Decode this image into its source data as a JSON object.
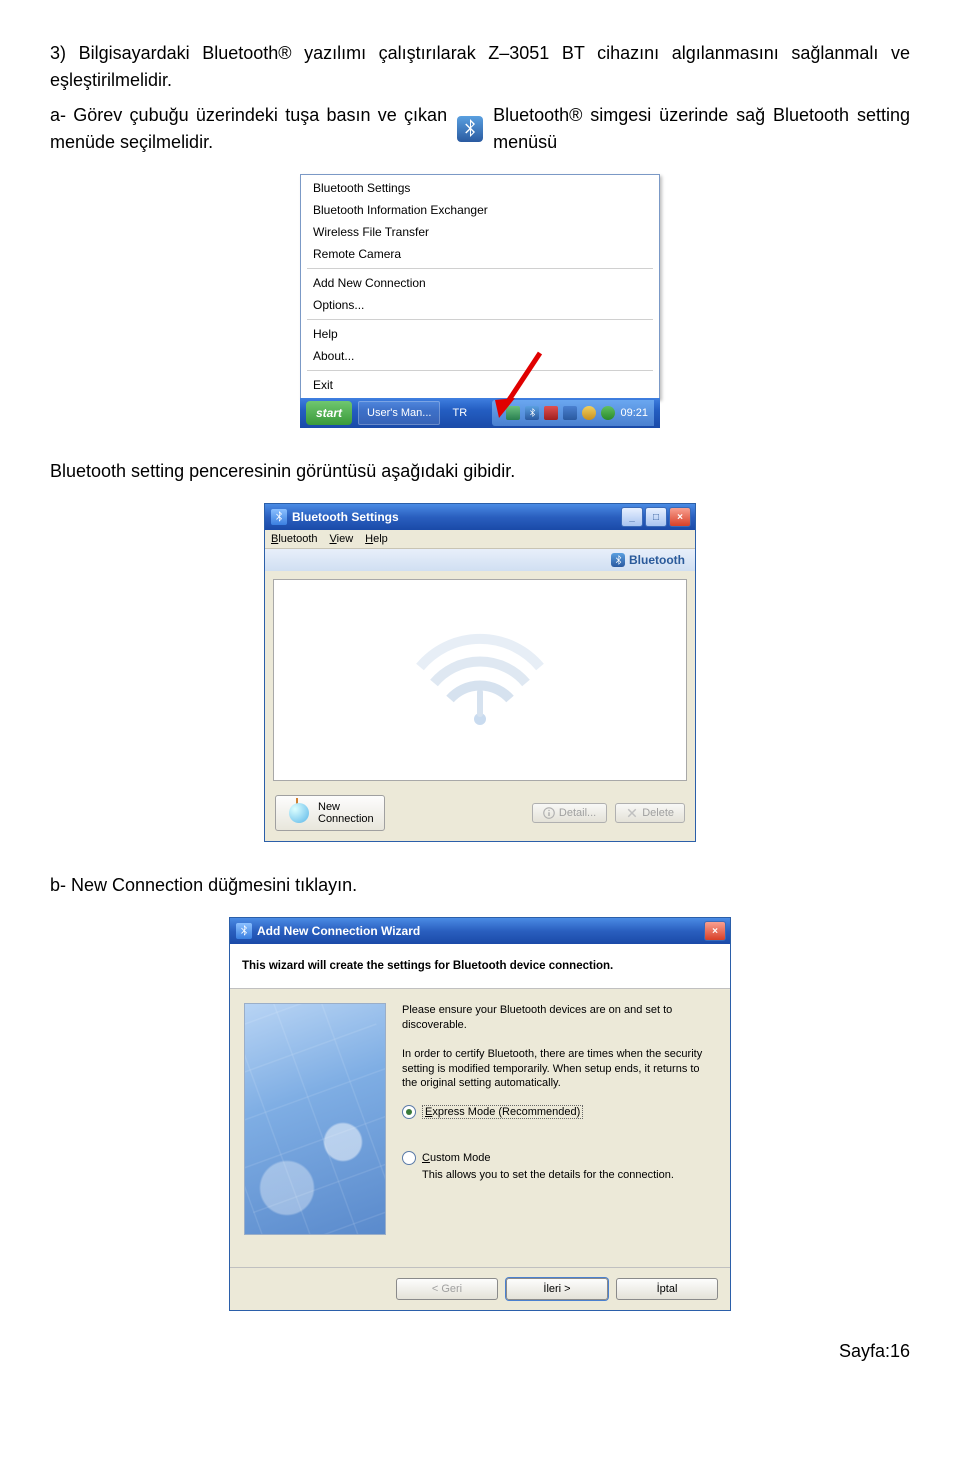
{
  "para1": "3) Bilgisayardaki Bluetooth® yazılımı çalıştırılarak Z–3051 BT cihazını algılanmasını sağlanmalı ve eşleştirilmelidir.",
  "para2_left": "a- Görev çubuğu üzerindeki tuşa basın ve çıkan menüde seçilmelidir.",
  "para2_right": "Bluetooth® simgesi üzerinde sağ Bluetooth setting menüsü",
  "context_menu": {
    "items_a": [
      "Bluetooth Settings",
      "Bluetooth Information Exchanger",
      "Wireless File Transfer",
      "Remote Camera"
    ],
    "items_b": [
      "Add New Connection",
      "Options..."
    ],
    "items_c": [
      "Help",
      "About..."
    ],
    "items_d": [
      "Exit"
    ]
  },
  "taskbar": {
    "start": "start",
    "task1": "User's Man...",
    "lang": "TR",
    "clock": "09:21"
  },
  "para3": "Bluetooth setting penceresinin görüntüsü aşağıdaki gibidir.",
  "btwin": {
    "title": "Bluetooth Settings",
    "menu": {
      "bluetooth": "Bluetooth",
      "view": "View",
      "help": "Help"
    },
    "brand": "Bluetooth",
    "newconn": "New\nConnection",
    "newconn_line1": "New",
    "newconn_line2": "Connection",
    "detail": "Detail...",
    "delete": "Delete"
  },
  "para4": "b- New Connection düğmesini tıklayın.",
  "wizard": {
    "title": "Add New Connection Wizard",
    "header": "This wizard will create the settings for Bluetooth device connection.",
    "p1": "Please ensure your Bluetooth devices are on and set to discoverable.",
    "p2": "In order to certify Bluetooth, there are times when the security setting is modified temporarily. When setup ends, it returns to the original setting automatically.",
    "opt1": "Express Mode (Recommended)",
    "opt1_u": "E",
    "opt2": "Custom Mode",
    "opt2_u": "C",
    "opt2_sub": "This allows you to set the details for the connection.",
    "back": "< Geri",
    "next": "İleri >",
    "cancel": "İptal"
  },
  "footer": "Sayfa:16"
}
